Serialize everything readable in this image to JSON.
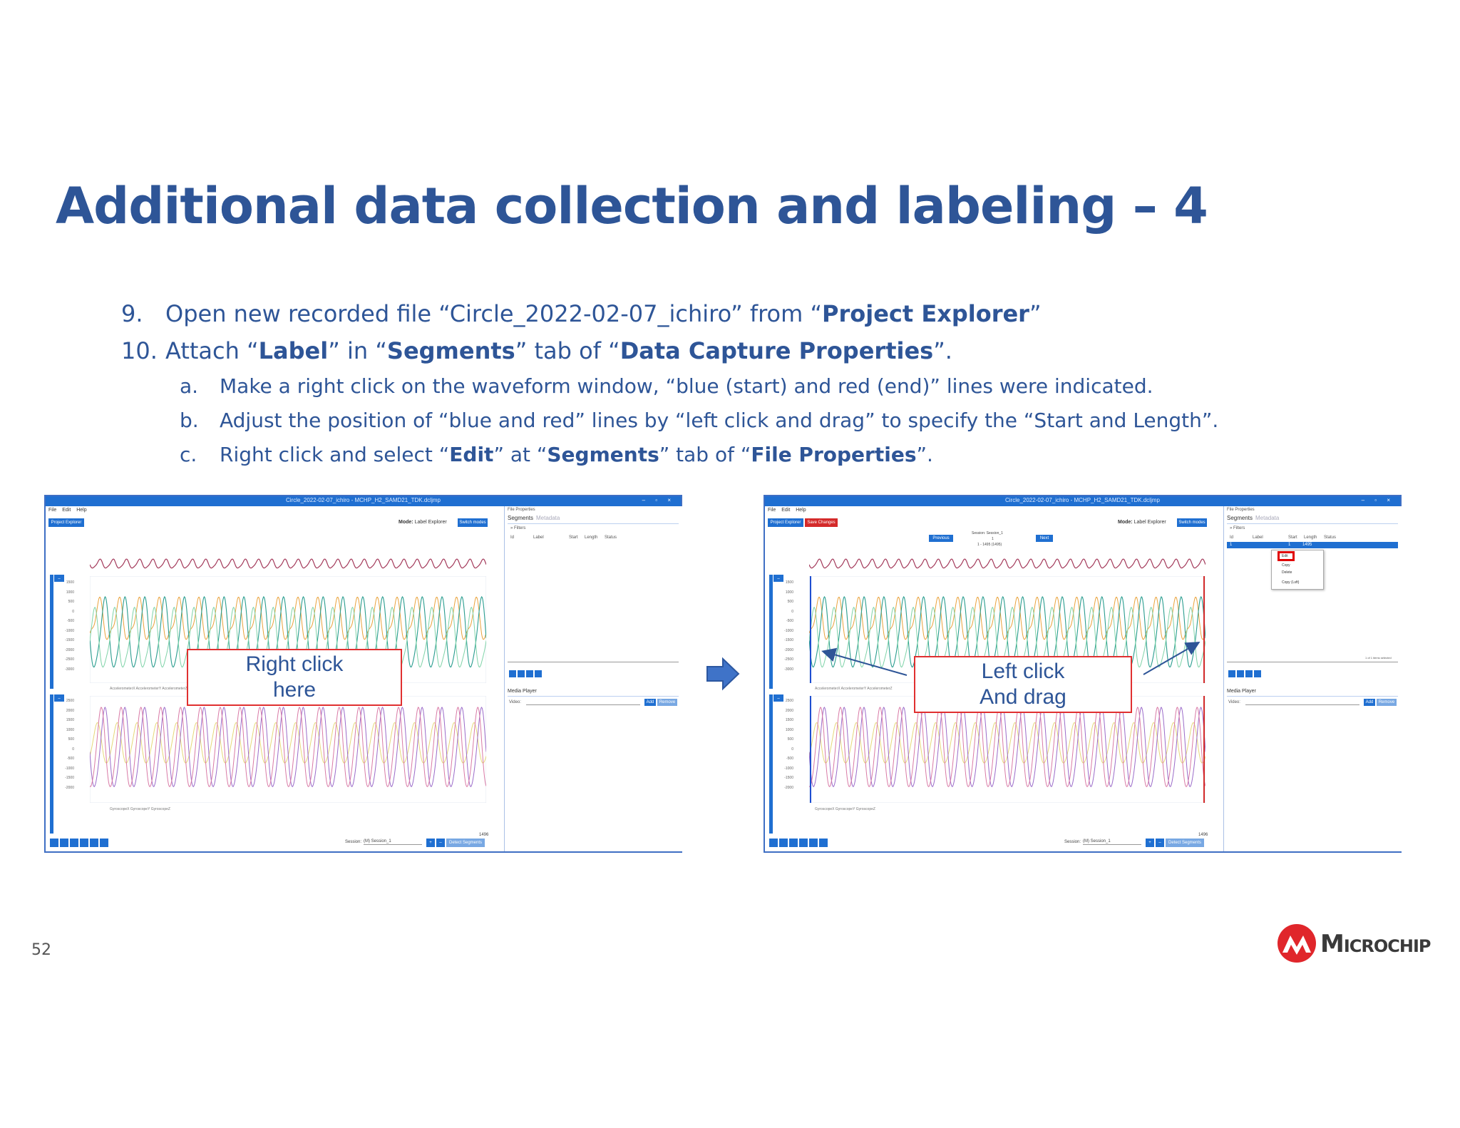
{
  "slide": {
    "title": "Additional data collection and labeling – 4",
    "page_number": "52"
  },
  "steps": [
    {
      "num": "9.",
      "pre": "Open new recorded file “Circle_2022-02-07_ichiro” from “",
      "bold1": "Project Explorer",
      "post": "”"
    },
    {
      "num": "10.",
      "pre": "Attach “",
      "bold1": "Label",
      "mid1": "” in “",
      "bold2": "Segments",
      "mid2": "” tab of “",
      "bold3": "Data Capture Properties",
      "post": "”."
    }
  ],
  "substeps": [
    {
      "num": "a.",
      "text": "Make a right click on the waveform window, “blue (start) and red (end)” lines were indicated."
    },
    {
      "num": "b.",
      "text": "Adjust the position of “blue and red” lines by “left click and drag” to specify the “Start and Length”."
    },
    {
      "num": "c.",
      "pre": "Right click and select “",
      "bold1": "Edit",
      "mid1": "” at “",
      "bold2": "Segments",
      "mid2": "” tab of “",
      "bold3": "File Properties",
      "post": "”."
    }
  ],
  "screenshots": {
    "left": {
      "window_title": "Circle_2022-02-07_ichiro - MCHP_H2_SAMD21_TDK.dcljmp",
      "window_controls": "– ▫ ×",
      "menu": "File Edit Help",
      "btn_project_explorer": "Project Explorer",
      "mode_label": "Mode:",
      "mode_value": "Label Explorer",
      "btn_switch_modes": "Switch modes",
      "panel_title": "File Properties",
      "tab_segments": "Segments",
      "tab_metadata": "Metadata",
      "filters": "» Filters",
      "columns": [
        "Id",
        "Label",
        "Start",
        "Length",
        "Status"
      ],
      "media_player": "Media Player",
      "video_label": "Video:",
      "btn_add": "Add",
      "btn_remove": "Remove",
      "session_label": "Session:",
      "session_value": "(M) Session_1",
      "sample_count": "1496",
      "btn_bottom": "Detect Segments",
      "y_labels_top": [
        "1500",
        "1000",
        "500",
        "0",
        "-500",
        "-1000",
        "-1500",
        "-2000",
        "-2500",
        "-3000"
      ],
      "y_labels_bottom": [
        "2500",
        "2000",
        "1500",
        "1000",
        "500",
        "0",
        "-500",
        "-1000",
        "-1500",
        "-2000"
      ],
      "legend_top": "AccelerometerX  AccelerometerY  AccelerometerZ",
      "legend_bottom": "GyroscopeX  GyroscopeY  GyroscopeZ"
    },
    "right": {
      "window_title": "Circle_2022-02-07_ichiro - MCHP_H2_SAMD21_TDK.dcljmp",
      "window_controls": "– ▫ ×",
      "menu": "File Edit Help",
      "btn_project_explorer": "Project Explorer",
      "btn_save_changes": "Save Changes",
      "btn_previous": "Previous",
      "btn_next": "Next",
      "session_header": "Session: Session_1",
      "segment_index": "1",
      "segment_range": "1 - 1495 (1495)",
      "mode_label": "Mode:",
      "mode_value": "Label Explorer",
      "btn_switch_modes": "Switch modes",
      "panel_title": "File Properties",
      "tab_segments": "Segments",
      "tab_metadata": "Metadata",
      "filters": "» Filters",
      "columns": [
        "Id",
        "Label",
        "Start",
        "Length",
        "Status"
      ],
      "selected_row": [
        "1",
        "",
        "1",
        "1495",
        ""
      ],
      "context_menu": [
        "Edit",
        "Copy",
        "Delete",
        "Copy (Lsft)"
      ],
      "items_selected": "1 of 1 items selected",
      "media_player": "Media Player",
      "video_label": "Video:",
      "btn_add": "Add",
      "btn_remove": "Remove",
      "session_label": "Session:",
      "session_value": "(M) Session_1",
      "sample_count": "1496",
      "btn_bottom": "Detect Segments",
      "y_labels_top": [
        "1500",
        "1000",
        "500",
        "0",
        "-500",
        "-1000",
        "-1500",
        "-2000",
        "-2500",
        "-3000"
      ],
      "y_labels_bottom": [
        "2500",
        "2000",
        "1500",
        "1000",
        "500",
        "0",
        "-500",
        "-1000",
        "-1500",
        "-2000"
      ],
      "legend_top": "AccelerometerX  AccelerometerY  AccelerometerZ",
      "legend_bottom": "GyroscopeX  GyroscopeY  GyroscopeZ"
    }
  },
  "callouts": {
    "left": [
      "Right click",
      "here"
    ],
    "right": [
      "Left click",
      "And drag"
    ]
  },
  "logo": {
    "wordmark": "Microchip"
  },
  "colors": {
    "title": "#2e5597",
    "window_blue": "#1f6fd1",
    "callout_border": "#e03030",
    "accel_x": "#2a9d8f",
    "accel_y": "#e9a23b",
    "accel_z": "#7fd3a8",
    "gyro_x": "#9b6bc9",
    "gyro_y": "#d97aa6",
    "gyro_z": "#e6d87a",
    "logo_red": "#e0262b"
  }
}
